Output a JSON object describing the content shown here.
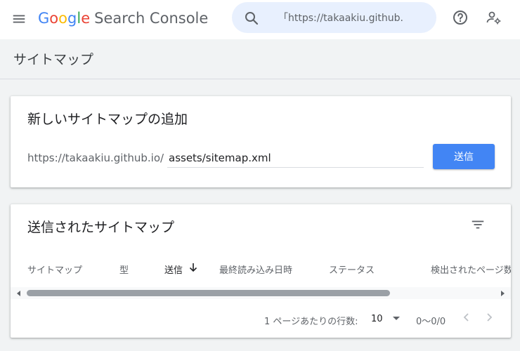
{
  "app": {
    "logo_word": "Google",
    "product_name": "Search Console",
    "search_value": "「https://takaakiu.github."
  },
  "page": {
    "title": "サイトマップ"
  },
  "add_sitemap": {
    "title": "新しいサイトマップの追加",
    "url_prefix": "https://takaakiu.github.io/",
    "input_value": "assets/sitemap.xml",
    "submit_label": "送信"
  },
  "submitted": {
    "title": "送信されたサイトマップ",
    "columns": [
      "サイトマップ",
      "型",
      "送信",
      "最終読み込み日時",
      "ステータス",
      "検出されたページ数"
    ],
    "pagination": {
      "rows_per_page_label": "1 ページあたりの行数:",
      "rows_per_page_value": "10",
      "range": "0〜0/0"
    }
  },
  "colors": {
    "accent": "#4285f4",
    "background": "#f1f3f4",
    "search_bg": "#e8f0fe"
  },
  "icons": [
    "menu-icon",
    "search-icon",
    "help-icon",
    "admin-settings-icon",
    "filter-icon",
    "arrow-down-icon",
    "chevron-left-icon",
    "chevron-right-icon"
  ]
}
